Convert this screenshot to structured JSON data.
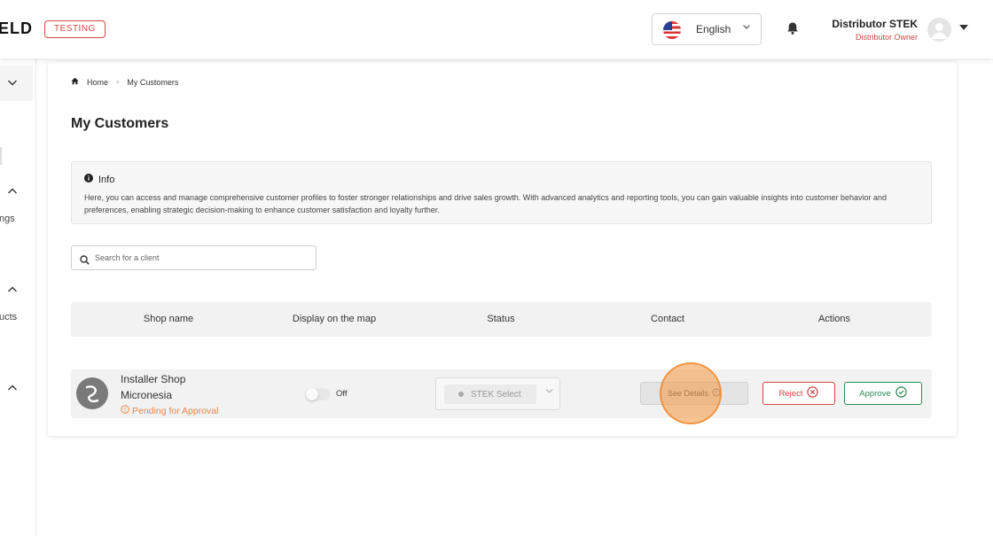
{
  "header": {
    "logo": "ELD",
    "env_badge": "TESTING",
    "language": "English",
    "user_name": "Distributor STEK",
    "user_role": "Distributor Owner"
  },
  "sidebar": {
    "items": [
      {
        "label": "ngs"
      },
      {
        "label": "ucts"
      }
    ]
  },
  "breadcrumb": {
    "home": "Home",
    "current": "My Customers"
  },
  "page": {
    "title": "My Customers"
  },
  "info": {
    "title": "Info",
    "body": "Here, you can access and manage comprehensive customer profiles to foster stronger relationships and drive sales growth. With advanced analytics and reporting tools, you can gain valuable insights into customer behavior and preferences, enabling strategic decision-making to enhance customer satisfaction and loyalty further."
  },
  "search": {
    "placeholder": "Search for a client",
    "value": ""
  },
  "table": {
    "columns": [
      "Shop name",
      "Display on the map",
      "Status",
      "Contact",
      "Actions"
    ],
    "rows": [
      {
        "shop_name": "Installer Shop Micronesia",
        "pending": "Pending for Approval",
        "display_on_map": "Off",
        "status": "STEK Select",
        "contact_button": "See Details",
        "reject_button": "Reject",
        "approve_button": "Approve"
      }
    ]
  },
  "colors": {
    "brand_red": "#d64545",
    "pending_orange": "#e8864a",
    "approve_green": "#2e8b57"
  }
}
